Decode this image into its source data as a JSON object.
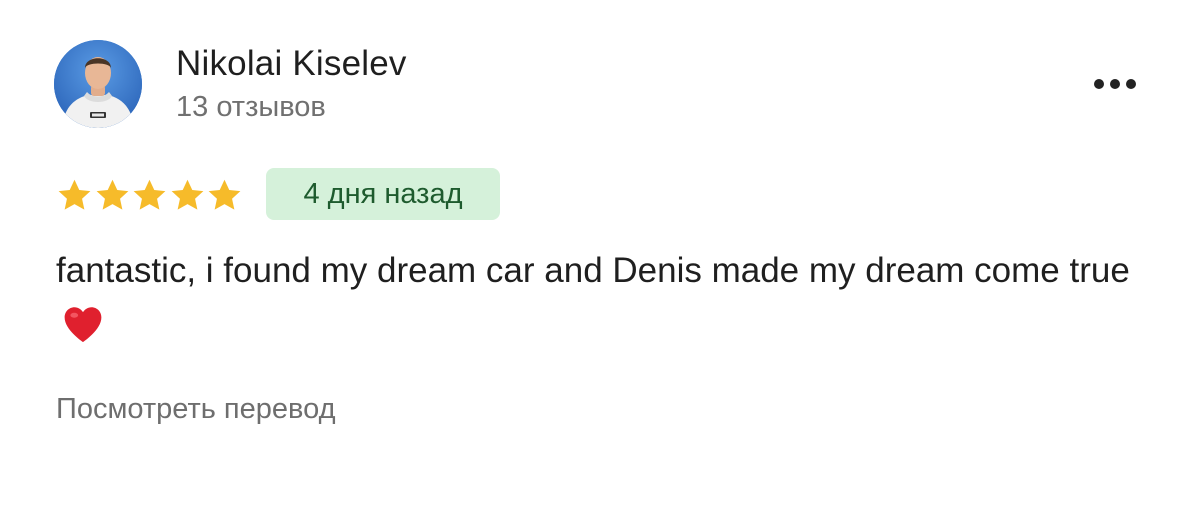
{
  "review": {
    "author_name": "Nikolai Kiselev",
    "review_count": "13 отзывов",
    "rating": 5,
    "rating_max": 5,
    "date": "4 дня назад",
    "text": "fantastic, i found my dream car and Denis made my dream come true",
    "emoji_icon": "heart-icon",
    "translate_link": "Посмотреть перевод"
  },
  "actions": {
    "more_icon": "more-options-icon"
  },
  "colors": {
    "star": "#F6BB2A",
    "badge_background": "#D5F1DA",
    "badge_text": "#1E5B2E",
    "secondary_text": "#707070",
    "heart": "#E0202E"
  }
}
